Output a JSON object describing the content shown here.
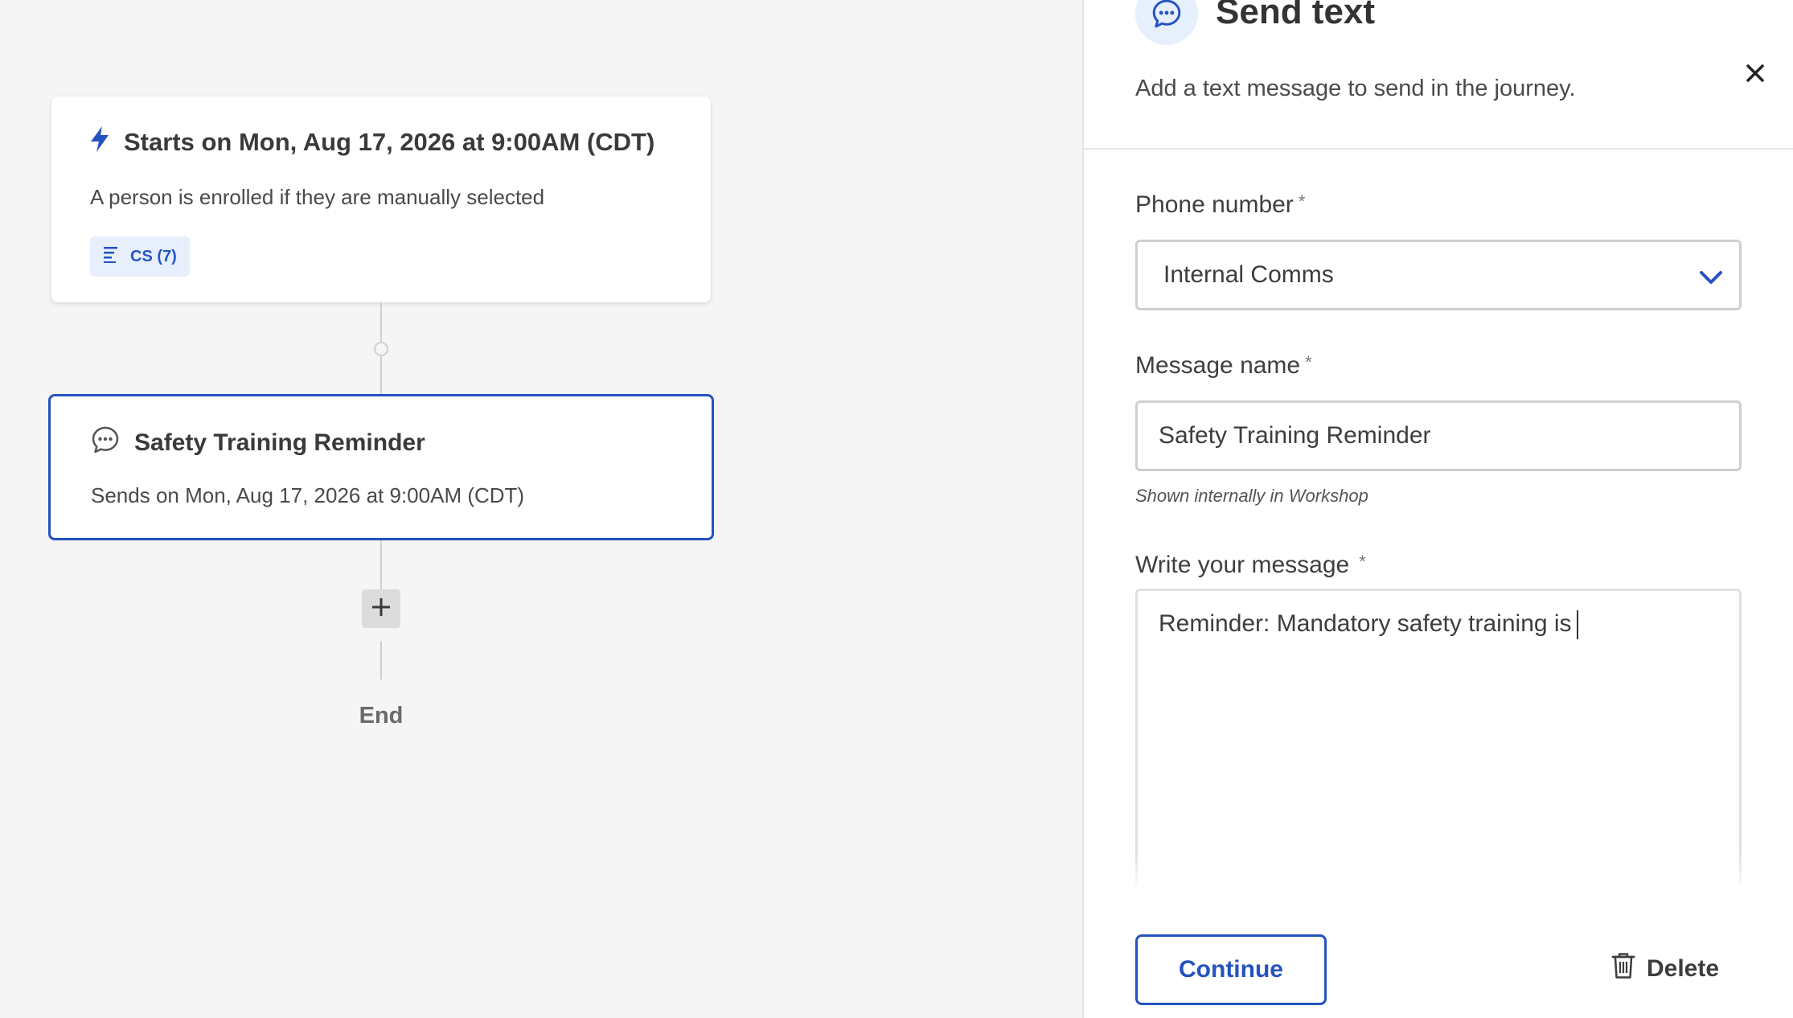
{
  "canvas": {
    "trigger": {
      "title": "Starts on Mon, Aug 17, 2026 at 9:00AM (CDT)",
      "description": "A person is enrolled if they are manually selected",
      "segment_chip": "CS (7)",
      "icon": "lightning-icon"
    },
    "step": {
      "title": "Safety Training Reminder",
      "description": "Sends on Mon, Aug 17, 2026 at 9:00AM (CDT)",
      "icon": "chat-bubble-icon"
    },
    "add_button_label": "+",
    "end_label": "End"
  },
  "panel": {
    "title": "Send text",
    "subtitle": "Add a text message to send in the journey.",
    "header_icon": "chat-bubble-icon",
    "close_icon": "close-icon",
    "phone_number": {
      "label": "Phone number",
      "required_mark": "*",
      "selected": "Internal Comms"
    },
    "message_name": {
      "label": "Message name",
      "required_mark": "*",
      "value": "Safety Training Reminder",
      "help": "Shown internally in Workshop"
    },
    "message": {
      "label": "Write your message",
      "required_mark": "*",
      "value": "Reminder: Mandatory safety training is"
    },
    "continue_label": "Continue",
    "delete_label": "Delete"
  },
  "colors": {
    "accent": "#2452c0",
    "chip_bg": "#e7effc",
    "canvas_bg": "#f5f5f5"
  }
}
